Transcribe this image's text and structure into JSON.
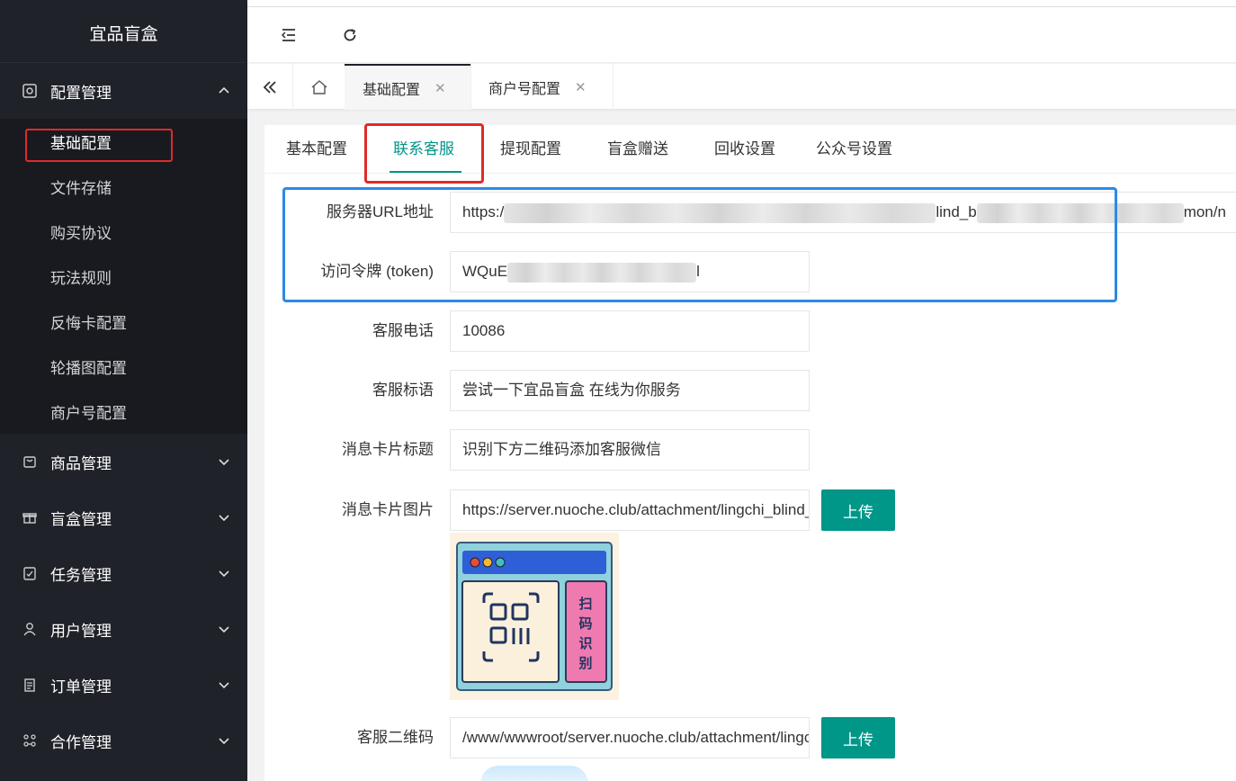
{
  "app": {
    "title": "宜品盲盒"
  },
  "sidebar": {
    "groups": [
      {
        "label": "配置管理",
        "icon": "settings-icon",
        "expanded": true,
        "items": [
          {
            "label": "基础配置",
            "active": true
          },
          {
            "label": "文件存储"
          },
          {
            "label": "购买协议"
          },
          {
            "label": "玩法规则"
          },
          {
            "label": "反悔卡配置"
          },
          {
            "label": "轮播图配置"
          },
          {
            "label": "商户号配置"
          }
        ]
      },
      {
        "label": "商品管理",
        "icon": "bag-icon"
      },
      {
        "label": "盲盒管理",
        "icon": "gift-icon"
      },
      {
        "label": "任务管理",
        "icon": "clipboard-check-icon"
      },
      {
        "label": "用户管理",
        "icon": "user-icon"
      },
      {
        "label": "订单管理",
        "icon": "list-icon"
      },
      {
        "label": "合作管理",
        "icon": "network-icon"
      }
    ]
  },
  "tabstrip": {
    "tabs": [
      {
        "label": "基础配置",
        "active": true
      },
      {
        "label": "商户号配置"
      }
    ]
  },
  "subtabs": [
    "基本配置",
    "联系客服",
    "提现配置",
    "盲盒赠送",
    "回收设置",
    "公众号设置"
  ],
  "form": {
    "server_url": {
      "label": "服务器URL地址",
      "prefix": "https:/",
      "mid": "lind_b",
      "suffix": "mon/n"
    },
    "token": {
      "label": "访问令牌 (token)",
      "prefix": "WQuE",
      "suffix": "l"
    },
    "phone": {
      "label": "客服电话",
      "value": "10086"
    },
    "slogan": {
      "label": "客服标语",
      "value": "尝试一下宜品盲盒 在线为你服务"
    },
    "card_title": {
      "label": "消息卡片标题",
      "value": "识别下方二维码添加客服微信"
    },
    "card_image": {
      "label": "消息卡片图片",
      "value": "https://server.nuoche.club/attachment/lingchi_blind_box/",
      "button": "上传"
    },
    "qrcode": {
      "label": "客服二维码",
      "value": "/www/wwwroot/server.nuoche.club/attachment/lingchi_blind_box/",
      "button": "上传"
    }
  },
  "qr_card": {
    "side_text": "扫码识别"
  },
  "colors": {
    "accent": "#009688",
    "sidebar_bg": "#20222a",
    "highlight_red": "#e02a2a",
    "highlight_blue": "#2b8ae6"
  }
}
